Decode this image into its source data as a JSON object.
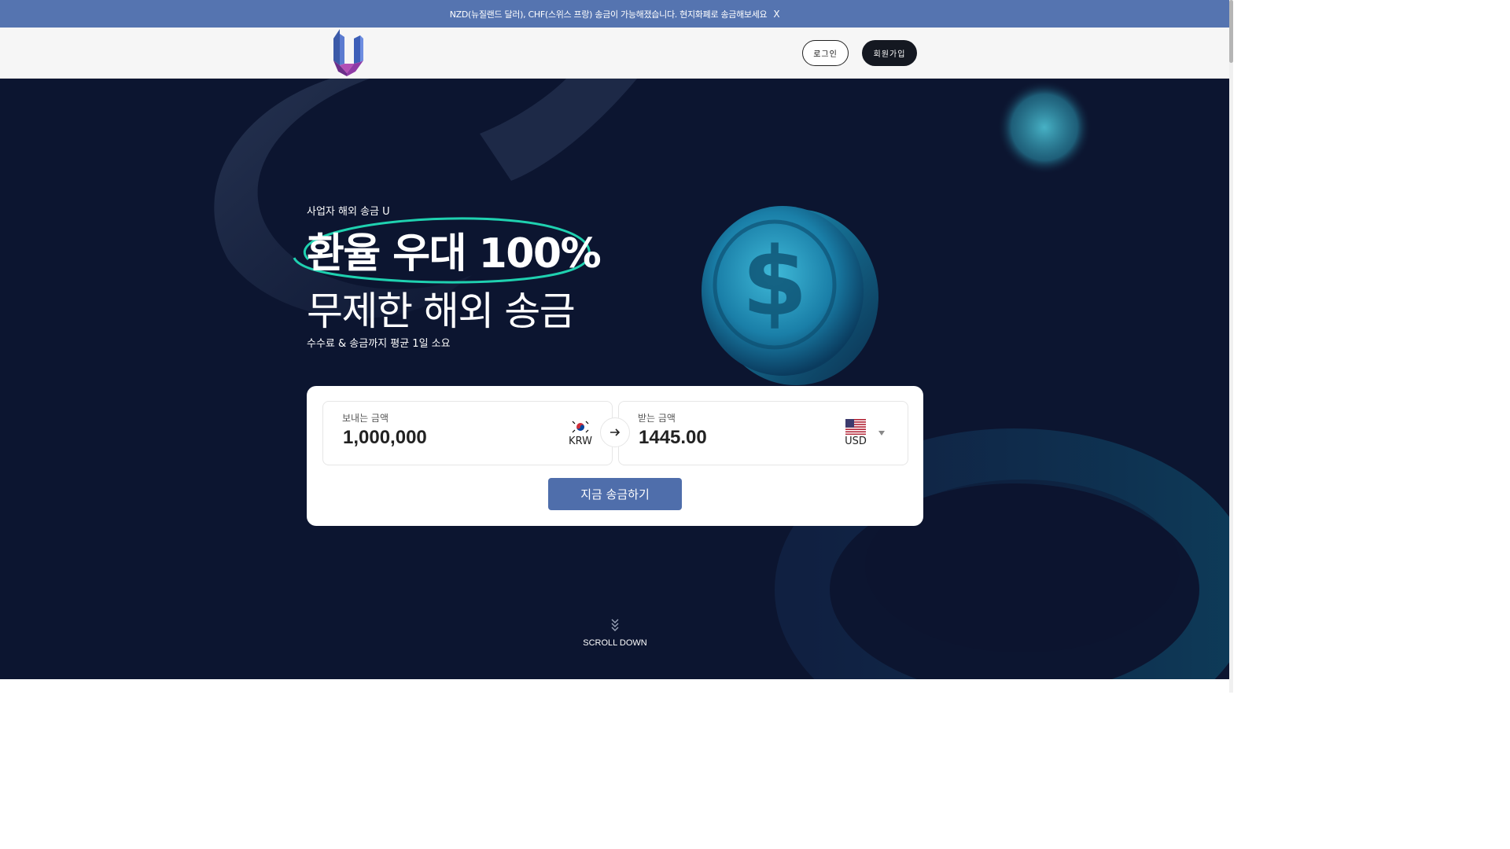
{
  "notice": {
    "text": "NZD(뉴질랜드 달러), CHF(스위스 프랑) 송금이 가능해졌습니다. 현지화폐로 송금해보세요",
    "close_label": "X"
  },
  "header": {
    "logo_icon": "u-logo-icon",
    "login_label": "로그인",
    "signup_label": "회원가입"
  },
  "hero": {
    "eyebrow": "사업자 해외 송금 U",
    "headline_1": "환율 우대 100%",
    "headline_2": "무제한 해외 송금",
    "subline": "수수료 & 송금까지 평균 1일 소요",
    "accent_color": "#1fd1b0"
  },
  "converter": {
    "send": {
      "label": "보내는 금액",
      "value": "1,000,000",
      "currency": "KRW",
      "flag_icon": "south-korea-flag-icon"
    },
    "arrow_icon": "arrow-right-icon",
    "receive": {
      "label": "받는 금액",
      "value": "1445.00",
      "currency": "USD",
      "flag_icon": "us-flag-icon"
    },
    "submit_label": "지금 송금하기",
    "button_color": "#4f6eab"
  },
  "scroll": {
    "label": "SCROLL DOWN",
    "icon": "double-chevron-down-icon"
  },
  "colors": {
    "notice_bg": "#5574b0",
    "hero_bg": "#0c1530",
    "coin": "#2aa6c8"
  }
}
